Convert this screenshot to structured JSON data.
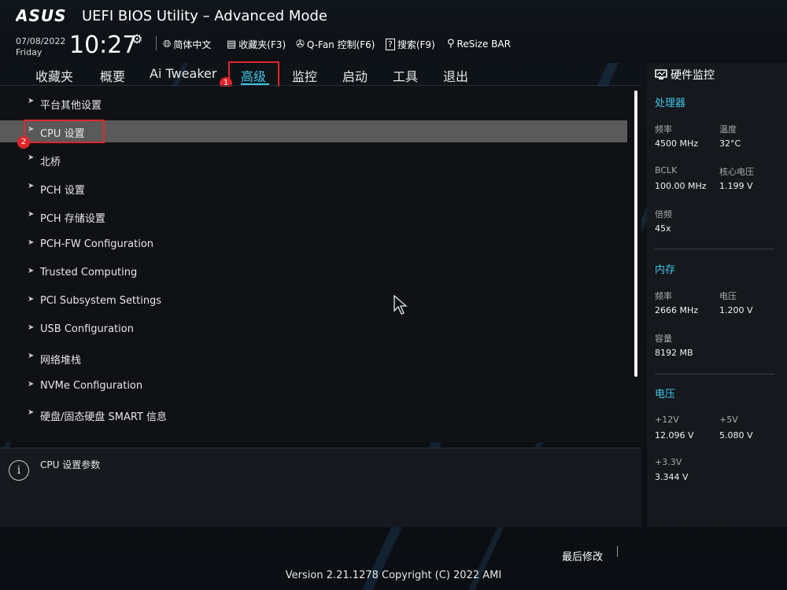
{
  "header": {
    "logo": "/ISUS",
    "title": "UEFI BIOS Utility – Advanced Mode",
    "date": "07/08/2022",
    "day": "Friday",
    "time": "10:27",
    "items": [
      {
        "icon": "globe-icon",
        "label": "简体中文"
      },
      {
        "icon": "favorites-icon",
        "label": "收藏夹(F3)"
      },
      {
        "icon": "fan-icon",
        "label": "Q-Fan 控制(F6)"
      },
      {
        "icon": "help-search-icon",
        "label": "搜索(F9)"
      },
      {
        "icon": "resize-bar-icon",
        "label": "ReSize BAR"
      }
    ]
  },
  "tabs": [
    {
      "label": "收藏夹"
    },
    {
      "label": "概要"
    },
    {
      "label": "Ai Tweaker"
    },
    {
      "label": "高级",
      "active": true
    },
    {
      "label": "监控"
    },
    {
      "label": "启动"
    },
    {
      "label": "工具"
    },
    {
      "label": "退出"
    }
  ],
  "annotations": {
    "tab_badge": "1",
    "item_badge": "2"
  },
  "menu": [
    {
      "label": "平台其他设置"
    },
    {
      "label": "CPU 设置",
      "selected": true
    },
    {
      "label": "北桥"
    },
    {
      "label": "PCH 设置"
    },
    {
      "label": "PCH 存储设置"
    },
    {
      "label": "PCH-FW Configuration"
    },
    {
      "label": "Trusted Computing"
    },
    {
      "label": "PCI Subsystem Settings"
    },
    {
      "label": "USB Configuration"
    },
    {
      "label": "网络堆栈"
    },
    {
      "label": "NVMe Configuration"
    },
    {
      "label": "硬盘/固态硬盘 SMART 信息"
    }
  ],
  "help": {
    "text": "CPU 设置参数"
  },
  "monitor": {
    "title": "硬件监控",
    "cpu": {
      "section": "处理器",
      "freq_label": "频率",
      "freq_value": "4500 MHz",
      "temp_label": "温度",
      "temp_value": "32°C",
      "bclk_label": "BCLK",
      "bclk_value": "100.00 MHz",
      "vcore_label": "核心电压",
      "vcore_value": "1.199 V",
      "ratio_label": "倍频",
      "ratio_value": "45x"
    },
    "memory": {
      "section": "内存",
      "freq_label": "频率",
      "freq_value": "2666 MHz",
      "volt_label": "电压",
      "volt_value": "1.200 V",
      "cap_label": "容量",
      "cap_value": "8192 MB"
    },
    "voltage": {
      "section": "电压",
      "v12_label": "+12V",
      "v12_value": "12.096 V",
      "v5_label": "+5V",
      "v5_value": "5.080 V",
      "v33_label": "+3.3V",
      "v33_value": "3.344 V"
    }
  },
  "footer": {
    "last_modified": "最后修改",
    "version": "Version 2.21.1278 Copyright (C) 2022 AMI"
  },
  "colors": {
    "accent": "#3fc7ea",
    "highlight_box": "#e2262b",
    "selected_row": "#5a5a5a"
  }
}
